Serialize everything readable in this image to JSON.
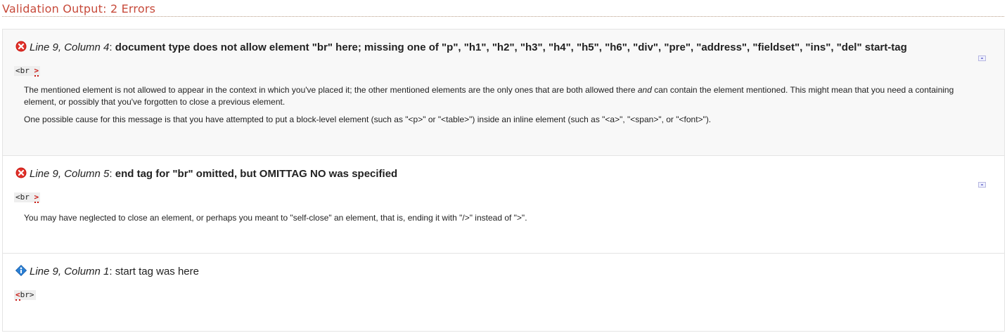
{
  "heading": "Validation Output: 2 Errors",
  "messages": [
    {
      "type": "error",
      "icon": "error-icon",
      "location": "Line 9, Column 4",
      "separator": ": ",
      "text": "document type does not allow element \"br\" here; missing one of \"p\", \"h1\", \"h2\", \"h3\", \"h4\", \"h5\", \"h6\", \"div\", \"pre\", \"address\", \"fieldset\", \"ins\", \"del\" start-tag",
      "code_before": "<br",
      "code_highlight": ">",
      "code_after": "",
      "explanation_1_a": "The mentioned element is not allowed to appear in the context in which you've placed it; the other mentioned elements are the only ones that are both allowed there ",
      "explanation_1_em": "and",
      "explanation_1_b": " can contain the element mentioned. This might mean that you need a containing element, or possibly that you've forgotten to close a previous element.",
      "explanation_2": "One possible cause for this message is that you have attempted to put a block-level element (such as \"<p>\" or \"<table>\") inside an inline element (such as \"<a>\", \"<span>\", or \"<font>\")."
    },
    {
      "type": "error",
      "icon": "error-icon",
      "location": "Line 9, Column 5",
      "separator": ": ",
      "text": "end tag for \"br\" omitted, but OMITTAG NO was specified",
      "code_before": "<br",
      "code_highlight": ">",
      "code_after": "",
      "explanation_1": "You may have neglected to close an element, or perhaps you meant to \"self-close\" an element, that is, ending it with \"/>\" instead of \">\"."
    },
    {
      "type": "info",
      "icon": "info-icon",
      "location": "Line 9, Column 1",
      "separator": ": ",
      "text": "start tag was here",
      "code_before": "",
      "code_highlight": "<",
      "code_after": "br>"
    }
  ],
  "colors": {
    "heading": "#c74a3a",
    "error_icon": "#c8150f",
    "info_icon": "#2b7fd4",
    "highlight": "#c8150f"
  }
}
